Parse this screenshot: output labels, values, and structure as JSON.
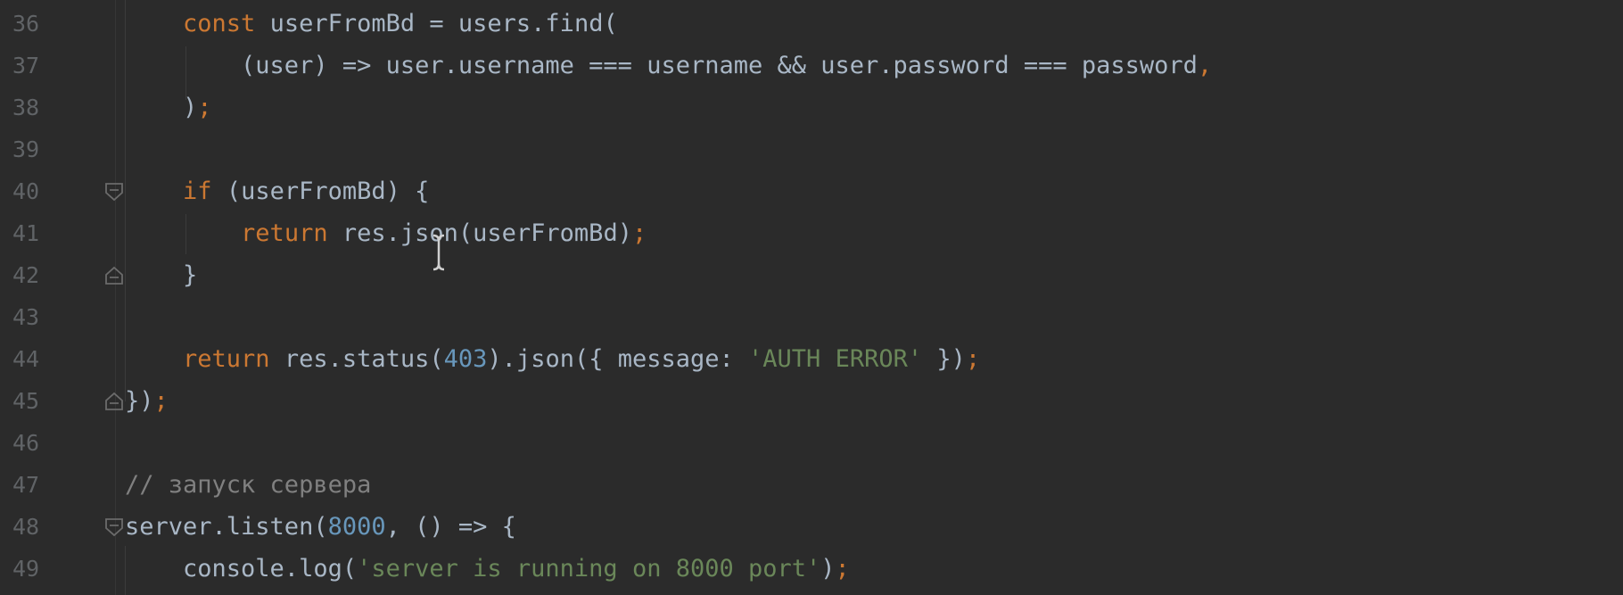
{
  "editor": {
    "colors": {
      "background": "#2b2b2b",
      "keyword": "#cc7832",
      "plain": "#a9b7c6",
      "string": "#6a8759",
      "number": "#6897bb",
      "comment": "#808080",
      "line_number": "#606366"
    },
    "lines": [
      {
        "number": "36",
        "tokens": [
          {
            "t": "    ",
            "c": "pl"
          },
          {
            "t": "const ",
            "c": "kw"
          },
          {
            "t": "userFromBd = users.find(",
            "c": "pl"
          }
        ]
      },
      {
        "number": "37",
        "tokens": [
          {
            "t": "        (user) => user.username === username && user.password === password",
            "c": "pl"
          },
          {
            "t": ",",
            "c": "kw"
          }
        ]
      },
      {
        "number": "38",
        "tokens": [
          {
            "t": "    ",
            "c": "pl"
          },
          {
            "t": ")",
            "c": "pl"
          },
          {
            "t": ";",
            "c": "kw"
          }
        ]
      },
      {
        "number": "39",
        "tokens": []
      },
      {
        "number": "40",
        "fold": "open",
        "tokens": [
          {
            "t": "    ",
            "c": "pl"
          },
          {
            "t": "if ",
            "c": "kw"
          },
          {
            "t": "(userFromBd) {",
            "c": "pl"
          }
        ]
      },
      {
        "number": "41",
        "tokens": [
          {
            "t": "        ",
            "c": "pl"
          },
          {
            "t": "return ",
            "c": "kw"
          },
          {
            "t": "res.json(userFromBd)",
            "c": "pl"
          },
          {
            "t": ";",
            "c": "kw"
          }
        ]
      },
      {
        "number": "42",
        "fold": "close",
        "tokens": [
          {
            "t": "    }",
            "c": "pl"
          }
        ]
      },
      {
        "number": "43",
        "tokens": []
      },
      {
        "number": "44",
        "tokens": [
          {
            "t": "    ",
            "c": "pl"
          },
          {
            "t": "return ",
            "c": "kw"
          },
          {
            "t": "res.status(",
            "c": "pl"
          },
          {
            "t": "403",
            "c": "num"
          },
          {
            "t": ").json({ message: ",
            "c": "pl"
          },
          {
            "t": "'AUTH ERROR'",
            "c": "str"
          },
          {
            "t": " })",
            "c": "pl"
          },
          {
            "t": ";",
            "c": "kw"
          }
        ]
      },
      {
        "number": "45",
        "fold": "close",
        "tokens": [
          {
            "t": "})",
            "c": "pl"
          },
          {
            "t": ";",
            "c": "kw"
          }
        ]
      },
      {
        "number": "46",
        "tokens": []
      },
      {
        "number": "47",
        "tokens": [
          {
            "t": "// запуск сервера",
            "c": "cm"
          }
        ]
      },
      {
        "number": "48",
        "fold": "open",
        "tokens": [
          {
            "t": "server.listen(",
            "c": "pl"
          },
          {
            "t": "8000",
            "c": "num"
          },
          {
            "t": ", () => {",
            "c": "pl"
          }
        ]
      },
      {
        "number": "49",
        "tokens": [
          {
            "t": "    console.log(",
            "c": "pl"
          },
          {
            "t": "'server is running on 8000 port'",
            "c": "str"
          },
          {
            "t": ")",
            "c": "pl"
          },
          {
            "t": ";",
            "c": "kw"
          }
        ]
      }
    ]
  },
  "icons": {
    "fold_open": "fold-open-icon",
    "fold_close": "fold-close-icon",
    "text_cursor": "text-cursor-icon"
  }
}
